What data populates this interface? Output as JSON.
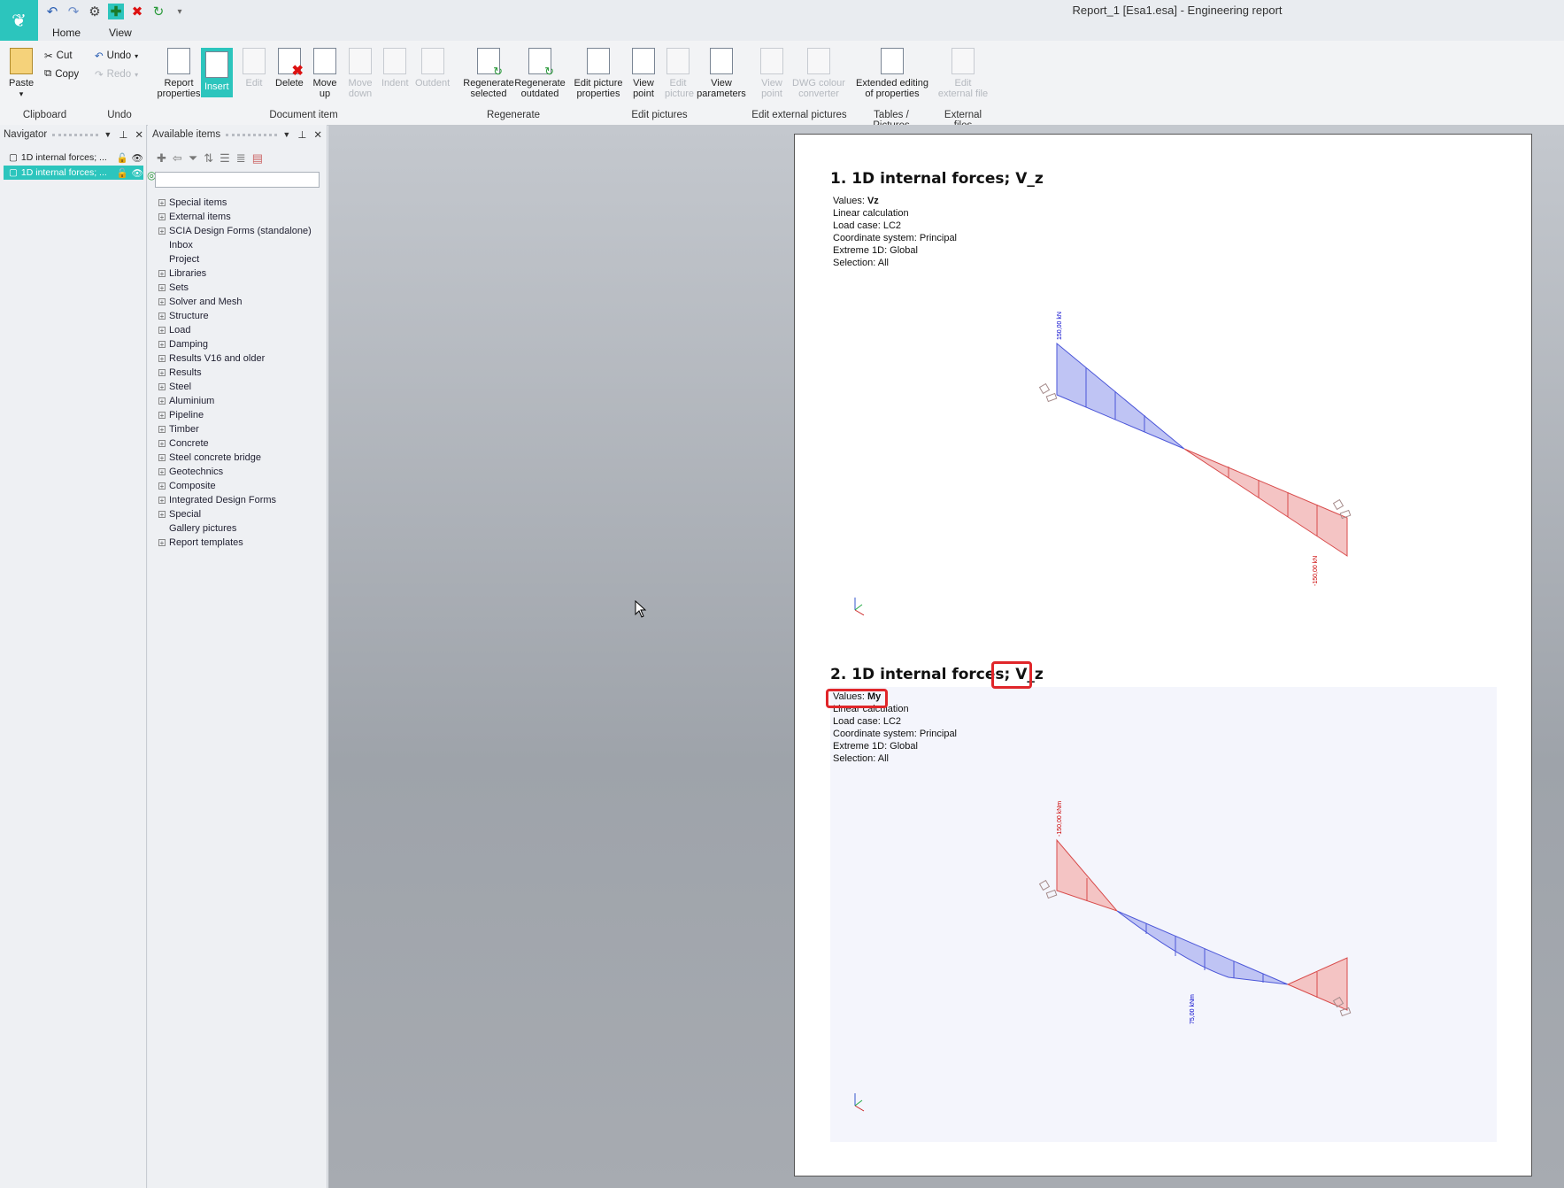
{
  "window": {
    "title": "Report_1 [Esa1.esa] - Engineering report"
  },
  "tabs": [
    "Home",
    "View"
  ],
  "ribbon": {
    "clipboard": {
      "paste": "Paste",
      "cut": "Cut",
      "copy": "Copy",
      "group": "Clipboard"
    },
    "undo": {
      "undo": "Undo",
      "redo": "Redo",
      "group": "Undo"
    },
    "document_item": {
      "report_properties": "Report properties",
      "insert": "Insert",
      "edit": "Edit",
      "delete": "Delete",
      "move_up": "Move up",
      "move_down": "Move down",
      "indent": "Indent",
      "outdent": "Outdent",
      "group": "Document item"
    },
    "regenerate": {
      "selected": "Regenerate selected",
      "outdated": "Regenerate outdated",
      "group": "Regenerate"
    },
    "edit_pictures": {
      "picture_properties": "Edit picture properties",
      "view_point": "View point",
      "edit_picture": "Edit picture",
      "view_parameters": "View parameters",
      "group": "Edit pictures"
    },
    "edit_external": {
      "view_point": "View point",
      "dwg": "DWG colour converter",
      "group": "Edit external pictures"
    },
    "tables": {
      "extended": "Extended editing of properties",
      "group": "Tables / Pictures"
    },
    "external_files": {
      "edit": "Edit external file",
      "group": "External files"
    }
  },
  "navigator": {
    "title": "Navigator",
    "items": [
      {
        "label": "1D internal forces; ..."
      },
      {
        "label": "1D internal forces; ..."
      }
    ]
  },
  "available": {
    "title": "Available items",
    "tree": [
      "Special items",
      "External items",
      "SCIA Design Forms (standalone)",
      "Inbox",
      "Project",
      "Libraries",
      "Sets",
      "Solver and Mesh",
      "Structure",
      "Load",
      "Damping",
      "Results V16 and older",
      "Results",
      "Steel",
      "Aluminium",
      "Pipeline",
      "Timber",
      "Concrete",
      "Steel concrete bridge",
      "Geotechnics",
      "Composite",
      "Integrated Design Forms",
      "Special",
      "Gallery pictures",
      "Report templates"
    ]
  },
  "report": {
    "section1": {
      "title_prefix": "1. 1D internal forces;",
      "title_value": "V_z",
      "values": "Values:",
      "values_sym": "Vz",
      "calc": "Linear calculation",
      "load_case": "Load case: LC2",
      "coord": "Coordinate system: Principal",
      "extreme": "Extreme 1D: Global",
      "selection": "Selection: All",
      "label_top": "150,00 kN",
      "label_bottom": "-150,00 kN"
    },
    "section2": {
      "title_prefix": "2. 1D internal forces;",
      "title_value": "V_z",
      "values": "Values:",
      "values_sym": "My",
      "calc": "Linear calculation",
      "load_case": "Load case: LC2",
      "coord": "Coordinate system: Principal",
      "extreme": "Extreme 1D: Global",
      "selection": "Selection: All",
      "label_top": "-150,00 kNm",
      "label_mid": "75,00 kNm"
    }
  },
  "colors": {
    "accent": "#2cc5bd",
    "highlight": "#e0262a",
    "positive": "#0000cc",
    "negative": "#cc0000"
  }
}
